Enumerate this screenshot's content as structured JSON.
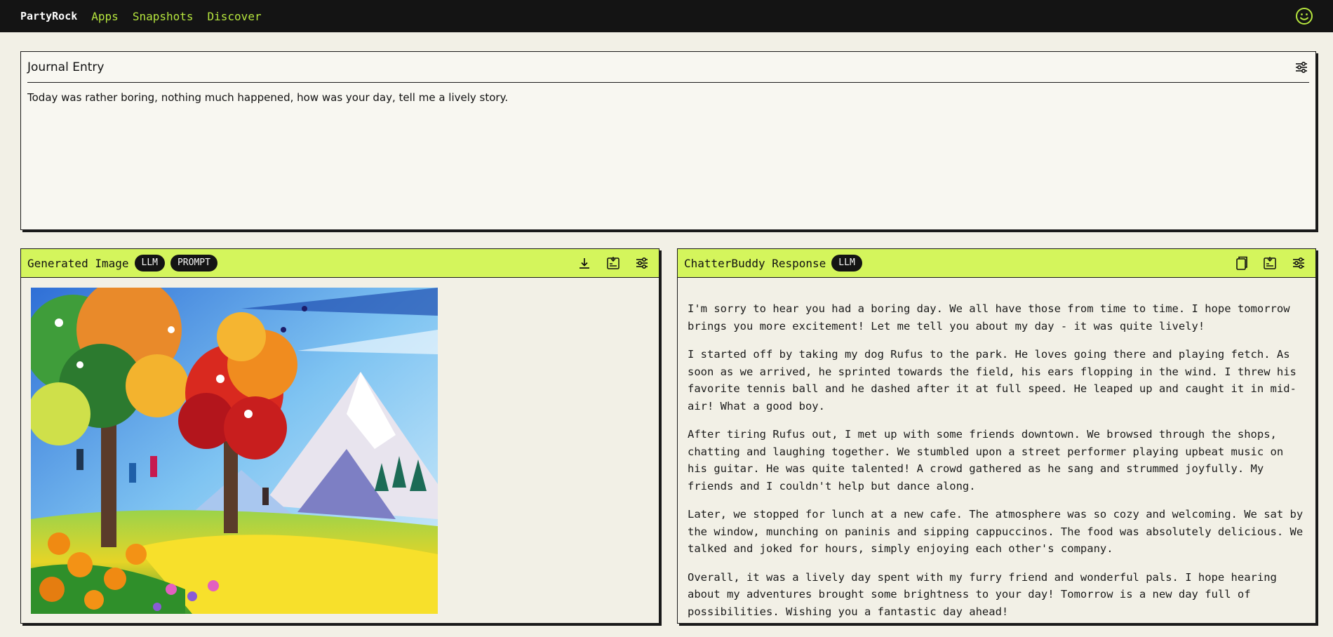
{
  "nav": {
    "brand": "PartyRock",
    "links": [
      "Apps",
      "Snapshots",
      "Discover"
    ],
    "avatar_icon": "smiley-icon"
  },
  "journal": {
    "title": "Journal Entry",
    "text": "Today was rather boring, nothing much happened, how was your day, tell me a lively story.",
    "settings_icon": "sliders-icon"
  },
  "image_widget": {
    "title": "Generated Image",
    "badges": [
      "LLM",
      "PROMPT"
    ],
    "icons": [
      "download-icon",
      "edit-prompt-icon",
      "sliders-icon"
    ]
  },
  "response_widget": {
    "title": "ChatterBuddy Response",
    "badges": [
      "LLM"
    ],
    "icons": [
      "copy-icon",
      "edit-prompt-icon",
      "sliders-icon"
    ],
    "paragraphs": [
      "I'm sorry to hear you had a boring day. We all have those from time to time. I hope tomorrow brings you more excitement! Let me tell you about my day - it was quite lively!",
      "I started off by taking my dog Rufus to the park. He loves going there and playing fetch. As soon as we arrived, he sprinted towards the field, his ears flopping in the wind. I threw his favorite tennis ball and he dashed after it at full speed. He leaped up and caught it in mid-air! What a good boy.",
      "After tiring Rufus out, I met up with some friends downtown. We browsed through the shops, chatting and laughing together. We stumbled upon a street performer playing upbeat music on his guitar. He was quite talented! A crowd gathered as he sang and strummed joyfully. My friends and I couldn't help but dance along.",
      "Later, we stopped for lunch at a new cafe. The atmosphere was so cozy and welcoming. We sat by the window, munching on paninis and sipping cappuccinos. The food was absolutely delicious. We talked and joked for hours, simply enjoying each other's company.",
      "Overall, it was a lively day spent with my furry friend and wonderful pals. I hope hearing about my adventures brought some brightness to your day! Tomorrow is a new day full of possibilities. Wishing you a fantastic day ahead!"
    ]
  },
  "colors": {
    "nav_bg": "#141414",
    "nav_link": "#b6e63e",
    "widget_header": "#d4f55c",
    "page_bg": "#f2f0e6"
  }
}
